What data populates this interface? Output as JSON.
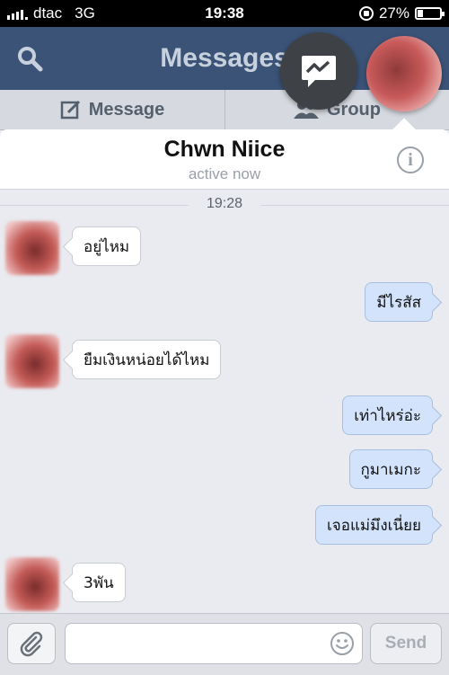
{
  "status_bar": {
    "carrier": "dtac",
    "network": "3G",
    "time": "19:38",
    "battery": "27%",
    "battery_level": 0.27
  },
  "nav": {
    "title": "Messages",
    "tabs": [
      {
        "label": "Message"
      },
      {
        "label": "Group"
      }
    ]
  },
  "conversation": {
    "contact_name": "Chwn Niice",
    "status": "active now",
    "timestamp": "19:28",
    "messages": [
      {
        "direction": "in",
        "text": "อยู่ไหม"
      },
      {
        "direction": "out",
        "text": "มีไรสัส"
      },
      {
        "direction": "in",
        "text": "ยืมเงินหน่อยได้ไหม"
      },
      {
        "direction": "out",
        "text": "เท่าไหร่อ่ะ"
      },
      {
        "direction": "out",
        "text": "กูมาเมกะ"
      },
      {
        "direction": "out",
        "text": "เจอแม่มึงเนี่ยย"
      },
      {
        "direction": "in",
        "text": "3พัน"
      }
    ]
  },
  "composer": {
    "placeholder": "",
    "send_label": "Send"
  },
  "colors": {
    "nav": "#3b5377",
    "outgoing_bubble": "#d3e3fb",
    "incoming_bubble": "#ffffff"
  }
}
